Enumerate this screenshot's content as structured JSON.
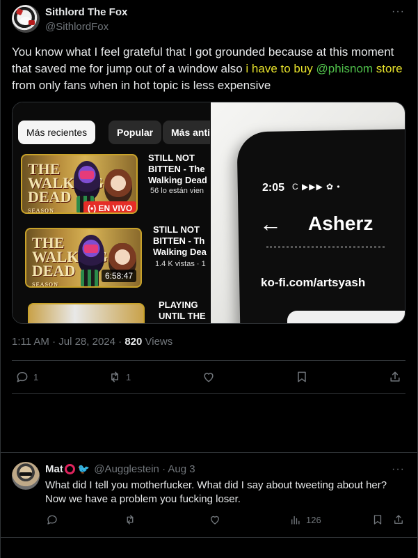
{
  "tweet": {
    "display_name": "Sithlord The Fox",
    "handle": "@SithlordFox",
    "text_part1": "You know what I feel grateful that I got grounded because at this moment that saved me for jump out of a window also ",
    "text_highlight": "i have to buy",
    "text_mention": "@phisnom",
    "text_store": " store",
    "text_part2": " from only fans when in hot topic is less expensive",
    "more_icon": "···",
    "timestamp": "1:11 AM · Jul 28, 2024 · ",
    "views_count": "820",
    "views_label": " Views",
    "reply_count": "1",
    "retweet_count": "1",
    "colors": {
      "highlight": "#e6e12b",
      "mention": "#4fbf4a"
    }
  },
  "media_left": {
    "tabs": [
      "Más recientes",
      "Popular",
      "Más anti"
    ],
    "videos": [
      {
        "logo": "THE WALKING DEAD",
        "logo_sub": "SEASON",
        "badge": "(•) EN VIVO",
        "title": "STILL NOT BITTEN - The Walking Dead",
        "meta": "56 lo están vien"
      },
      {
        "logo": "THE WALKING DEAD",
        "logo_sub": "SEASON",
        "duration": "6:58:47",
        "title": "STILL NOT BITTEN - Th Walking Dea",
        "meta": "1.4 K vistas · 1"
      },
      {
        "title": "PLAYING UNTIL THE"
      }
    ]
  },
  "media_right": {
    "time": "2:05",
    "status_icons": "C ▶▶▶ ✿ •",
    "back_icon": "←",
    "name": "Asherz",
    "link": "ko-fi.com/artsyash"
  },
  "reply": {
    "display_name": "Mat",
    "handle": "@Augglestein · Aug 3",
    "text": "What did I tell you motherfucker. What did I say about tweeting about her? Now we have a problem you fucking loser.",
    "views_count": "126",
    "more_icon": "···"
  }
}
